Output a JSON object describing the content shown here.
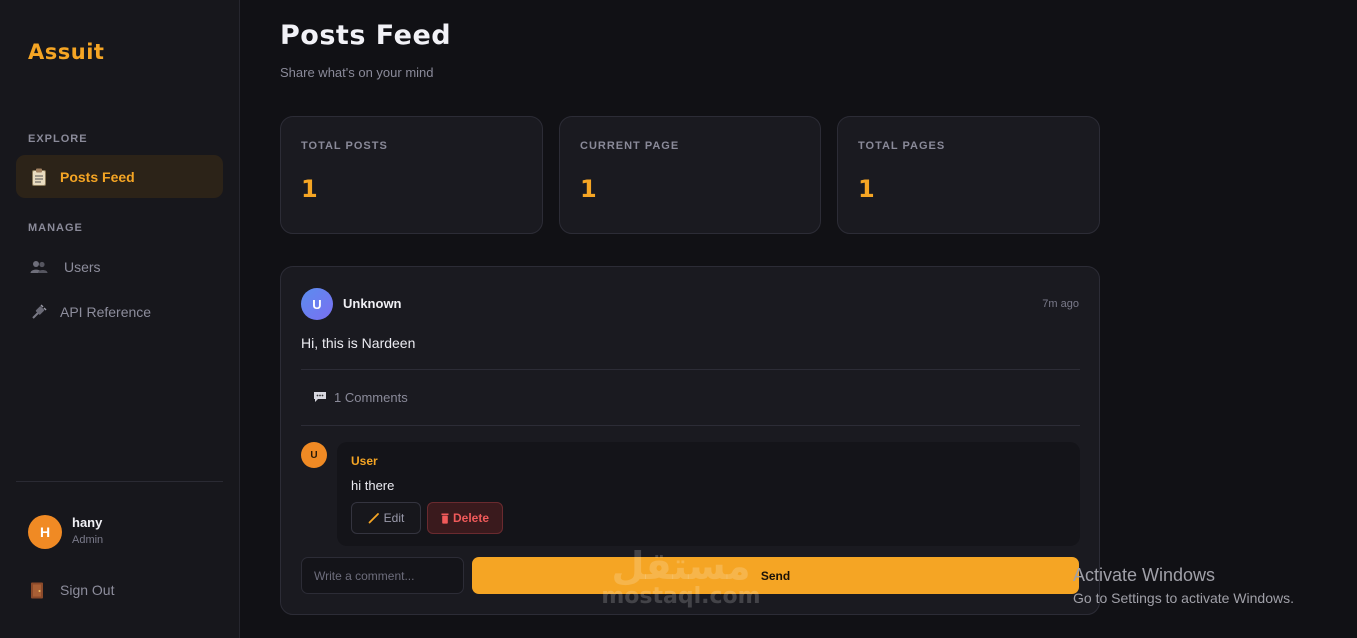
{
  "sidebar": {
    "brand": "Assuit",
    "explore_label": "EXPLORE",
    "manage_label": "MANAGE",
    "nav": {
      "posts_feed": {
        "label": "Posts Feed",
        "icon": "clipboard-icon"
      },
      "users": {
        "label": "Users",
        "icon": "users-icon"
      },
      "api_reference": {
        "label": "API Reference",
        "icon": "plug-icon"
      }
    },
    "user": {
      "initial": "H",
      "name": "hany",
      "role": "Admin"
    },
    "sign_out": {
      "label": "Sign Out",
      "icon": "door-icon"
    }
  },
  "header": {
    "title": "Posts Feed",
    "subtitle": "Share what's on your mind"
  },
  "stats": [
    {
      "label": "TOTAL POSTS",
      "value": "1"
    },
    {
      "label": "CURRENT PAGE",
      "value": "1"
    },
    {
      "label": "TOTAL PAGES",
      "value": "1"
    }
  ],
  "post": {
    "avatar_initial": "U",
    "author": "Unknown",
    "time": "7m ago",
    "content": "Hi, this is Nardeen",
    "comments_label": "1 Comments",
    "comment": {
      "avatar_initial": "U",
      "author": "User",
      "text": "hi there",
      "edit_label": "Edit",
      "delete_label": "Delete"
    },
    "input_placeholder": "Write a comment...",
    "send_label": "Send"
  },
  "overlays": {
    "watermark_arabic": "مستقل",
    "watermark_latin": "mostaql.com",
    "activate_title": "Activate Windows",
    "activate_sub": "Go to Settings to activate Windows."
  },
  "colors": {
    "accent": "#f5a524",
    "background": "#111115",
    "danger": "#f05a5a"
  }
}
